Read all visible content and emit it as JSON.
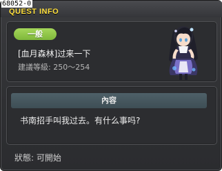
{
  "quest_id": "68052-0",
  "window": {
    "title": "QUEST INFO"
  },
  "quest": {
    "category": "一般",
    "name": "[血月森林]过来一下",
    "recommended_level": "建議等級: 250〜254"
  },
  "npc": {
    "portrait": "npc-portrait"
  },
  "content": {
    "header": "內容",
    "text": "书南招手叫我过去。有什么事吗?"
  },
  "status": "狀態: 可開始",
  "colors": {
    "title": "#ffe040",
    "badge": "#8dc447",
    "content_header": "#46575e",
    "window_bg": "#2f3033"
  }
}
